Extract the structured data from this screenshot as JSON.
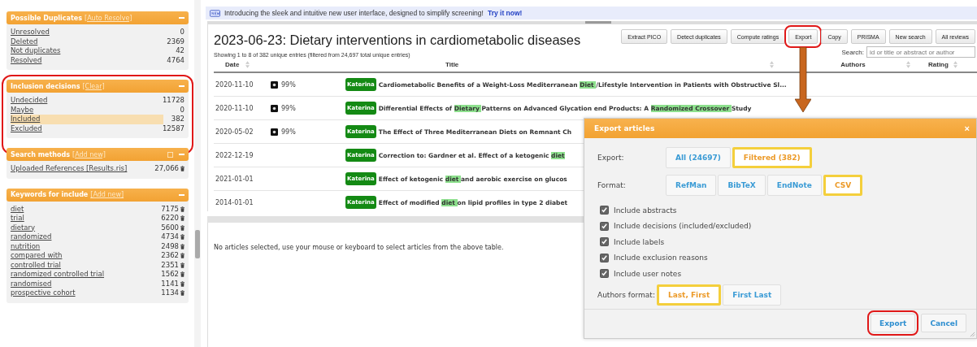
{
  "banner": {
    "text": "Introducing the sleek and intuitive new user interface, designed to simplify screening!",
    "link": "Try it now!"
  },
  "sidebar": [
    {
      "title": "Possible Duplicates",
      "action": "[Auto Resolve]",
      "callout": false,
      "has_options": false,
      "deletable": false,
      "items": [
        {
          "label": "Unresolved",
          "count": "0",
          "selected": false
        },
        {
          "label": "Deleted",
          "count": "2369",
          "selected": false
        },
        {
          "label": "Not duplicates",
          "count": "42",
          "selected": false
        },
        {
          "label": "Resolved",
          "count": "4764",
          "selected": false
        }
      ]
    },
    {
      "title": "Inclusion decisions",
      "action": "[Clear]",
      "callout": true,
      "has_options": false,
      "deletable": false,
      "items": [
        {
          "label": "Undecided",
          "count": "11728",
          "selected": false
        },
        {
          "label": "Maybe",
          "count": "0",
          "selected": false
        },
        {
          "label": "Included",
          "count": "382",
          "selected": true
        },
        {
          "label": "Excluded",
          "count": "12587",
          "selected": false
        }
      ]
    },
    {
      "title": "Search methods",
      "action": "[Add new]",
      "callout": false,
      "has_options": true,
      "deletable": true,
      "items": [
        {
          "label": "Uploaded References [Results.ris]",
          "count": "27,066",
          "selected": false
        }
      ]
    },
    {
      "title": "Keywords for include",
      "action": "[Add new]",
      "callout": false,
      "has_options": false,
      "deletable": true,
      "items": [
        {
          "label": "diet",
          "count": "7175",
          "selected": false
        },
        {
          "label": "trial",
          "count": "6220",
          "selected": false
        },
        {
          "label": "dietary",
          "count": "5600",
          "selected": false
        },
        {
          "label": "randomized",
          "count": "4734",
          "selected": false
        },
        {
          "label": "nutrition",
          "count": "2498",
          "selected": false
        },
        {
          "label": "compared with",
          "count": "2362",
          "selected": false
        },
        {
          "label": "controlled trial",
          "count": "2351",
          "selected": false
        },
        {
          "label": "randomized controlled trial",
          "count": "1562",
          "selected": false
        },
        {
          "label": "randomised",
          "count": "1141",
          "selected": false
        },
        {
          "label": "prospective cohort",
          "count": "1134",
          "selected": false
        }
      ]
    }
  ],
  "review": {
    "title": "2023-06-23: Dietary interventions in cardiometabolic diseases",
    "summary": "Showing 1 to 8 of 382 unique entries (filtered from 24,697 total unique entries)",
    "toolbar": [
      {
        "label": "Extract PICO",
        "callout": false
      },
      {
        "label": "Detect duplicates",
        "callout": false
      },
      {
        "label": "Compute ratings",
        "callout": false
      },
      {
        "label": "Export",
        "callout": true
      },
      {
        "label": "Copy",
        "callout": false
      },
      {
        "label": "PRISMA",
        "callout": false
      },
      {
        "label": "New search",
        "callout": false
      },
      {
        "label": "All reviews",
        "callout": false
      }
    ],
    "search": {
      "label": "Search:",
      "placeholder": "id or title or abstract or author"
    }
  },
  "table": {
    "columns": [
      {
        "label": "Date",
        "sortable": true
      },
      {
        "label": "Title",
        "sortable": true
      },
      {
        "label": "Authors",
        "sortable": true
      },
      {
        "label": "Rating",
        "sortable": true
      }
    ],
    "rows": [
      {
        "date": "2020-11-10",
        "score": "99%",
        "reviewer": "Katerina",
        "title": [
          {
            "text": "Cardiometabolic Benefits of a Weight-Loss Mediterranean ",
            "highlight": false
          },
          {
            "text": "Diet ",
            "highlight": true
          },
          {
            "text": "/Lifestyle Intervention in Patients with Obstructive Sl...",
            "highlight": false
          }
        ]
      },
      {
        "date": "2020-11-10",
        "score": "99%",
        "reviewer": "Katerina",
        "title": [
          {
            "text": "Differential Effects of ",
            "highlight": false
          },
          {
            "text": "Dietary ",
            "highlight": true
          },
          {
            "text": "Patterns on Advanced Glycation end Products: A ",
            "highlight": false
          },
          {
            "text": "Randomized  Crossover ",
            "highlight": true
          },
          {
            "text": "Study",
            "highlight": false
          }
        ]
      },
      {
        "date": "2020-05-02",
        "score": "99%",
        "reviewer": "Katerina",
        "title": [
          {
            "text": "The Effect of Three Mediterranean Diets on Remnant Ch",
            "highlight": false
          }
        ]
      },
      {
        "date": "2022-12-19",
        "reviewer": "Katerina",
        "title": [
          {
            "text": "Correction to: Gardner et al. Effect of a ketogenic ",
            "highlight": false
          },
          {
            "text": "diet ",
            "highlight": true
          }
        ]
      },
      {
        "date": "2021-01-01",
        "reviewer": "Katerina",
        "title": [
          {
            "text": "Effect of ketogenic ",
            "highlight": false
          },
          {
            "text": "diet ",
            "highlight": true
          },
          {
            "text": "and aerobic exercise on glucos",
            "highlight": false
          }
        ]
      },
      {
        "date": "2014-01-01",
        "reviewer": "Katerina",
        "title": [
          {
            "text": "Effect of modified ",
            "highlight": false
          },
          {
            "text": "diet ",
            "highlight": true
          },
          {
            "text": "on lipid profiles in type 2 diabet",
            "highlight": false
          }
        ]
      }
    ]
  },
  "detail": {
    "text": "No articles selected, use your mouse or keyboard to select articles from the above table."
  },
  "dialog": {
    "title": "Export articles",
    "close": "×",
    "sections": [
      {
        "kind": "choice",
        "label": "Export:",
        "options": [
          {
            "label": "All (24697)",
            "selected": false
          },
          {
            "label": "Filtered (382)",
            "selected": true
          }
        ]
      },
      {
        "kind": "choice",
        "label": "Format:",
        "options": [
          {
            "label": "RefMan",
            "selected": false
          },
          {
            "label": "BibTeX",
            "selected": false
          },
          {
            "label": "EndNote",
            "selected": false
          },
          {
            "label": "CSV",
            "selected": true
          }
        ]
      },
      {
        "kind": "checkbox",
        "label": "Include abstracts",
        "checked": true
      },
      {
        "kind": "checkbox",
        "label": "Include decisions (included/excluded)",
        "checked": true
      },
      {
        "kind": "checkbox",
        "label": "Include labels",
        "checked": true
      },
      {
        "kind": "checkbox",
        "label": "Include exclusion reasons",
        "checked": true
      },
      {
        "kind": "checkbox",
        "label": "Include user notes",
        "checked": true
      },
      {
        "kind": "choice",
        "label": "Authors format:",
        "options": [
          {
            "label": "Last, First",
            "selected": true
          },
          {
            "label": "First Last",
            "selected": false
          }
        ]
      }
    ],
    "buttons": [
      {
        "label": "Export",
        "callout": true
      },
      {
        "label": "Cancel",
        "callout": false
      }
    ]
  }
}
